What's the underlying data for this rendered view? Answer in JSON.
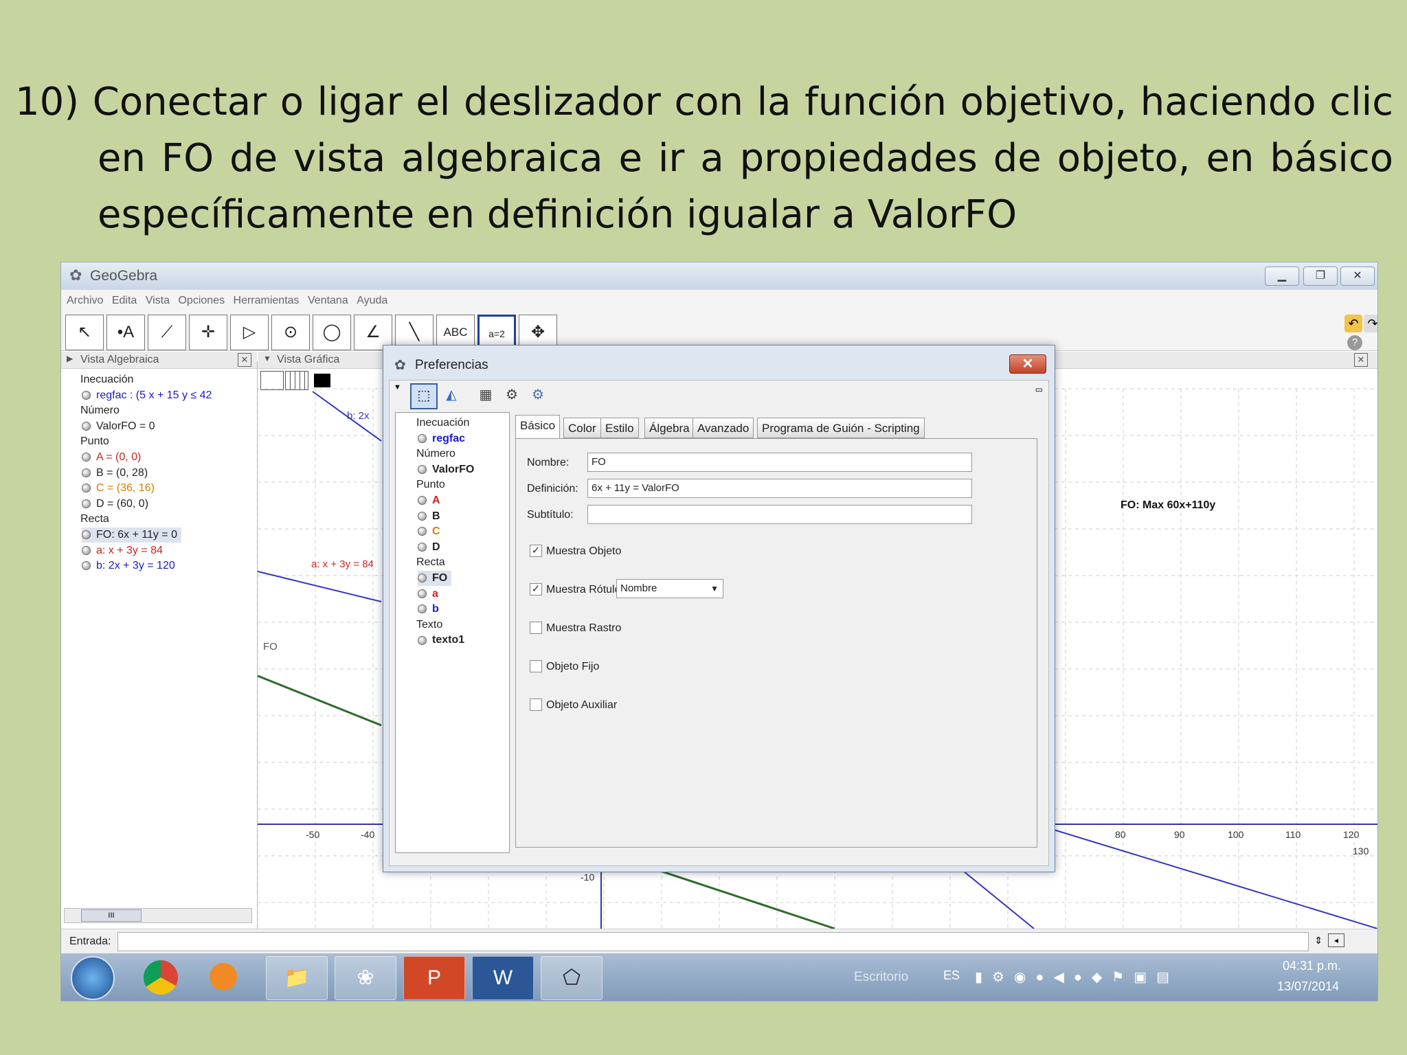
{
  "slide": {
    "lines": [
      "10) Conectar o ligar el deslizador con la función objetivo, haciendo clic",
      "en FO de vista algebraica e ir a propiedades de objeto, en básico",
      "específicamente en definición igualar a ValorFO"
    ]
  },
  "window": {
    "title": "GeoGebra",
    "menu": [
      "Archivo",
      "Edita",
      "Vista",
      "Opciones",
      "Herramientas",
      "Ventana",
      "Ayuda"
    ],
    "tools": [
      "↖",
      "•A",
      "⟋",
      "✛",
      "▷",
      "⊙",
      "◯",
      "∠",
      "╲",
      "ABC",
      "a=2",
      "✥"
    ]
  },
  "algebra": {
    "header": "Vista Algebraica",
    "groups": [
      {
        "cat": "Inecuación",
        "items": [
          {
            "text": "regfac :  (5 x + 15 y ≤ 42",
            "color": "#1a1acc"
          }
        ]
      },
      {
        "cat": "Número",
        "items": [
          {
            "text": "ValorFO = 0",
            "color": "#222222"
          }
        ]
      },
      {
        "cat": "Punto",
        "items": [
          {
            "text": "A = (0, 0)",
            "color": "#cc2222"
          },
          {
            "text": "B = (0, 28)",
            "color": "#222222"
          },
          {
            "text": "C = (36, 16)",
            "color": "#d47c00"
          },
          {
            "text": "D = (60, 0)",
            "color": "#222222"
          }
        ]
      },
      {
        "cat": "Recta",
        "items": [
          {
            "text": "FO: 6x + 11y = 0",
            "color": "#222222"
          },
          {
            "text": "a: x + 3y = 84",
            "color": "#cc2222"
          },
          {
            "text": "b: 2x + 3y = 120",
            "color": "#1a1acc"
          }
        ]
      }
    ]
  },
  "graphics": {
    "header": "Vista Gráfica",
    "labels": {
      "fo": "FO",
      "a": "a: x + 3y = 84",
      "b": "b: 2x",
      "fo_text": "FO: Max  60x+110y"
    },
    "x_ticks": [
      "-50",
      "-40",
      "80",
      "90",
      "100",
      "110",
      "120",
      "130"
    ],
    "y_tick": "-10"
  },
  "dialog": {
    "title": "Preferencias",
    "tree": [
      {
        "cat": "Inecuación",
        "items": [
          {
            "text": "regfac",
            "color": "#1a1acc"
          }
        ]
      },
      {
        "cat": "Número",
        "items": [
          {
            "text": "ValorFO",
            "color": "#222222"
          }
        ]
      },
      {
        "cat": "Punto",
        "items": [
          {
            "text": "A",
            "color": "#cc2222"
          },
          {
            "text": "B",
            "color": "#222222"
          },
          {
            "text": "C",
            "color": "#d47c00"
          },
          {
            "text": "D",
            "color": "#222222"
          }
        ]
      },
      {
        "cat": "Recta",
        "items": [
          {
            "text": "FO",
            "color": "#222222"
          },
          {
            "text": "a",
            "color": "#cc2222"
          },
          {
            "text": "b",
            "color": "#1a1acc"
          }
        ]
      },
      {
        "cat": "Texto",
        "items": [
          {
            "text": "texto1",
            "color": "#222222"
          }
        ]
      }
    ],
    "tabs": [
      "Básico",
      "Color",
      "Estilo",
      "Álgebra",
      "Avanzado",
      "Programa de Guión - Scripting"
    ],
    "nombre_label": "Nombre:",
    "nombre_value": "FO",
    "definicion_label": "Definición:",
    "definicion_value": "6x + 11y = ValorFO",
    "subtitulo_label": "Subtítulo:",
    "subtitulo_value": "",
    "muestra_objeto": "Muestra Objeto",
    "muestra_rotulo": "Muestra Rótulo:",
    "rotulo_select": "Nombre",
    "muestra_rastro": "Muestra Rastro",
    "objeto_fijo": "Objeto Fijo",
    "objeto_auxiliar": "Objeto Auxiliar"
  },
  "entrada": {
    "label": "Entrada:",
    "value": ""
  },
  "taskbar": {
    "escritorio": "Escritorio",
    "lang": "ES",
    "time": "04:31 p.m.",
    "date": "13/07/2014"
  }
}
